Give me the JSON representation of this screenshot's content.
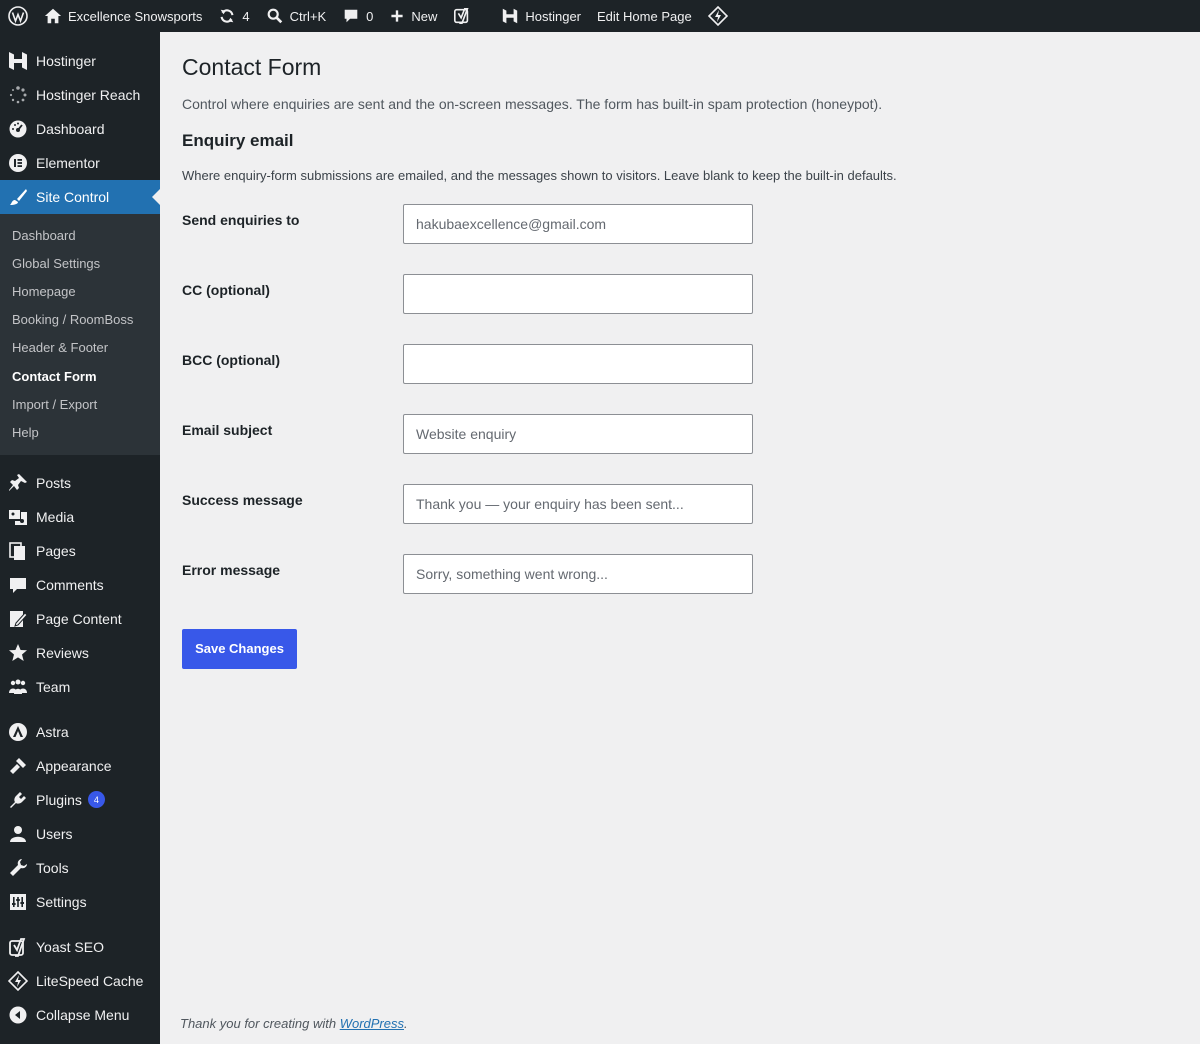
{
  "adminbar": {
    "site_name": "Excellence Snowsports",
    "updates_count": "4",
    "search_shortcut": "Ctrl+K",
    "comments_count": "0",
    "new_label": "New",
    "hostinger_label": "Hostinger",
    "edit_label": "Edit Home Page"
  },
  "sidebar": {
    "top_items": [
      {
        "label": "Hostinger",
        "icon": "hostinger-icon"
      },
      {
        "label": "Hostinger Reach",
        "icon": "reach-icon"
      },
      {
        "label": "Dashboard",
        "icon": "dashboard-icon"
      },
      {
        "label": "Elementor",
        "icon": "elementor-icon"
      },
      {
        "label": "Site Control",
        "icon": "brush-icon"
      }
    ],
    "submenu": [
      "Dashboard",
      "Global Settings",
      "Homepage",
      "Booking / RoomBoss",
      "Header & Footer",
      "Contact Form",
      "Import / Export",
      "Help"
    ],
    "content_items": [
      {
        "label": "Posts",
        "icon": "pin-icon"
      },
      {
        "label": "Media",
        "icon": "media-icon"
      },
      {
        "label": "Pages",
        "icon": "pages-icon"
      },
      {
        "label": "Comments",
        "icon": "comments-icon"
      },
      {
        "label": "Page Content",
        "icon": "page-content-icon"
      },
      {
        "label": "Reviews",
        "icon": "star-icon"
      },
      {
        "label": "Team",
        "icon": "team-icon"
      }
    ],
    "appearance_items": [
      {
        "label": "Astra",
        "icon": "astra-icon"
      },
      {
        "label": "Appearance",
        "icon": "appearance-icon"
      },
      {
        "label": "Plugins",
        "icon": "plugins-icon",
        "badge": "4"
      },
      {
        "label": "Users",
        "icon": "users-icon"
      },
      {
        "label": "Tools",
        "icon": "tools-icon"
      },
      {
        "label": "Settings",
        "icon": "settings-icon"
      }
    ],
    "bottom_items": [
      {
        "label": "Yoast SEO",
        "icon": "yoast-icon"
      },
      {
        "label": "LiteSpeed Cache",
        "icon": "litespeed-icon"
      },
      {
        "label": "Collapse Menu",
        "icon": "collapse-icon"
      }
    ]
  },
  "main": {
    "title": "Contact Form",
    "lead": "Control where enquiries are sent and the on-screen messages. The form has built-in spam protection (honeypot).",
    "section_title": "Enquiry email",
    "section_desc": "Where enquiry-form submissions are emailed, and the messages shown to visitors. Leave blank to keep the built-in defaults.",
    "fields": [
      {
        "label": "Send enquiries to",
        "value": "",
        "placeholder": "hakubaexcellence@gmail.com"
      },
      {
        "label": "CC (optional)",
        "value": "",
        "placeholder": ""
      },
      {
        "label": "BCC (optional)",
        "value": "",
        "placeholder": ""
      },
      {
        "label": "Email subject",
        "value": "",
        "placeholder": "Website enquiry"
      },
      {
        "label": "Success message",
        "value": "",
        "placeholder": "Thank you — your enquiry has been sent..."
      },
      {
        "label": "Error message",
        "value": "",
        "placeholder": "Sorry, something went wrong..."
      }
    ],
    "save_label": "Save Changes"
  },
  "footer": {
    "text": "Thank you for creating with ",
    "link": "WordPress",
    "end": "."
  }
}
